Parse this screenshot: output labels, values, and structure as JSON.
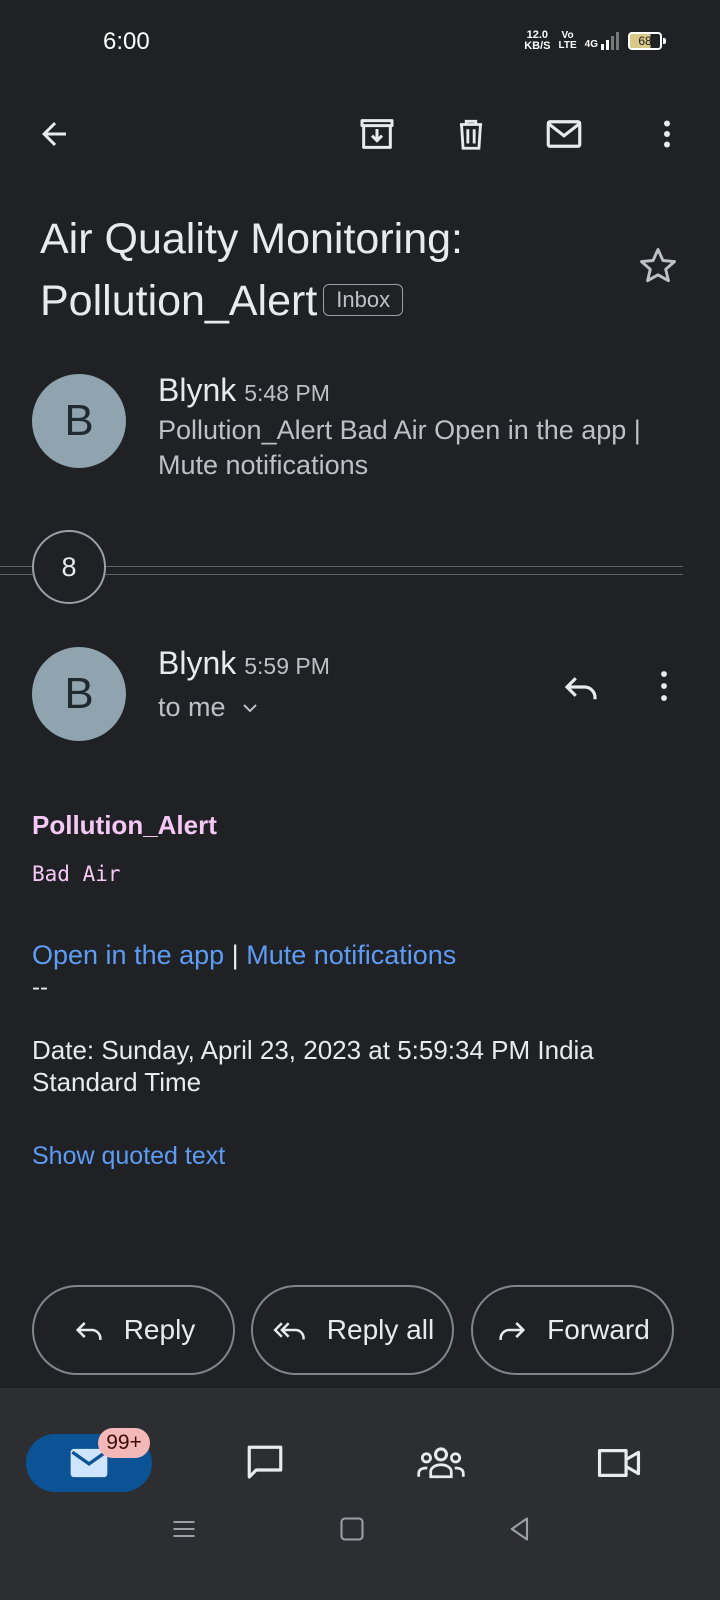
{
  "status_bar": {
    "time": "6:00",
    "net_speed_value": "12.0",
    "net_speed_unit": "KB/S",
    "volte_top": "Vo",
    "volte_bottom": "LTE",
    "network": "4G",
    "battery": "68"
  },
  "toolbar": {
    "icons": [
      "back-arrow-icon",
      "archive-icon",
      "delete-icon",
      "mark-unread-icon",
      "more-vert-icon"
    ]
  },
  "subject": {
    "line1": "Air Quality Monitoring:",
    "line2": "Pollution_Alert",
    "label": "Inbox"
  },
  "collapsed_message": {
    "avatar_letter": "B",
    "sender": "Blynk",
    "time": "5:48 PM",
    "snippet": "Pollution_Alert Bad Air Open in the app | Mute notifications"
  },
  "hidden_count": "8",
  "open_message": {
    "avatar_letter": "B",
    "sender": "Blynk",
    "time": "5:59 PM",
    "recipient": "to me",
    "body": {
      "title": "Pollution_Alert",
      "text": "Bad Air",
      "link_open": "Open in the app",
      "separator": "|",
      "link_mute": "Mute notifications",
      "dash": "--",
      "date": "Date: Sunday, April 23, 2023 at 5:59:34 PM India Standard Time",
      "show_quoted": "Show quoted text"
    }
  },
  "actions": {
    "reply": "Reply",
    "reply_all": "Reply all",
    "forward": "Forward"
  },
  "bottom_nav": {
    "mail_badge": "99+"
  },
  "colors": {
    "background": "#202124",
    "link": "#5d9cf5",
    "alert_text": "#f6c8f6",
    "avatar": "#8fa4ae",
    "nav_active": "#0b5394",
    "badge": "#f4b8b8"
  }
}
